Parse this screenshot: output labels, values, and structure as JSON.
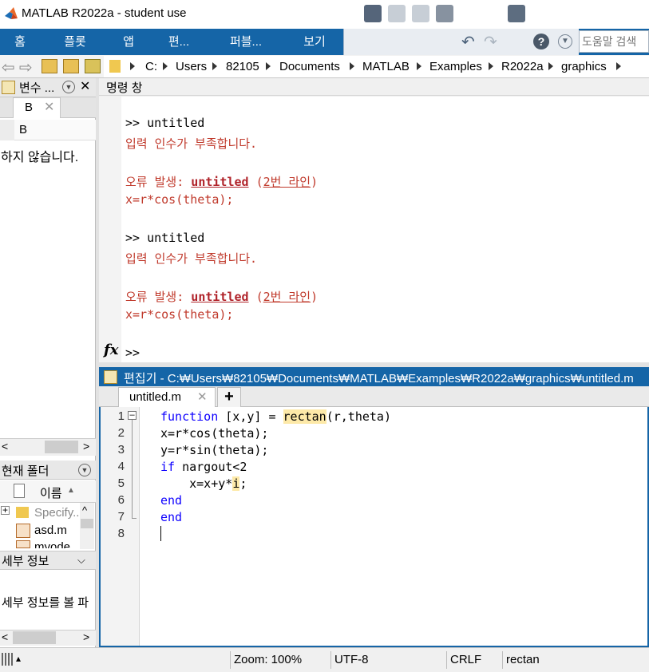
{
  "window": {
    "title": "MATLAB R2022a - student use"
  },
  "ribbon": {
    "tabs": [
      "홈",
      "플롯",
      "앱",
      "편...",
      "퍼블...",
      "보기"
    ],
    "help_search_placeholder": "도움말 검색"
  },
  "address": {
    "crumbs": [
      "C:",
      "Users",
      "82105",
      "Documents",
      "MATLAB",
      "Examples",
      "R2022a",
      "graphics"
    ]
  },
  "workspace_panel": {
    "title": "변수 ...",
    "tab_label": "B",
    "var_header": "B",
    "content": "하지 않습니다."
  },
  "current_folder_panel": {
    "title": "현재 폴더",
    "col_name": "이름",
    "items": [
      "Specify..",
      "asd.m",
      "myode..."
    ]
  },
  "details_panel": {
    "title": "세부 정보",
    "content": "세부 정보를 볼 파"
  },
  "command_window": {
    "title": "명령 창",
    "prompt": ">>",
    "fx": "fx",
    "blocks": [
      {
        "cmd": ">> untitled",
        "err1": "입력 인수가 부족합니다.",
        "err_prefix": "오류 발생: ",
        "err_func": "untitled",
        "err_open": " (",
        "err_line": "2번 라인",
        "err_close": ")",
        "err_code": "x=r*cos(theta);"
      },
      {
        "cmd": ">> untitled",
        "err1": "입력 인수가 부족합니다.",
        "err_prefix": "오류 발생: ",
        "err_func": "untitled",
        "err_open": " (",
        "err_line": "2번 라인",
        "err_close": ")",
        "err_code": "x=r*cos(theta);"
      }
    ]
  },
  "editor": {
    "title": "편집기 - C:₩Users₩82105₩Documents₩MATLAB₩Examples₩R2022a₩graphics₩untitled.m",
    "tab": "untitled.m",
    "add_tab": "+",
    "line_numbers": [
      "1",
      "2",
      "3",
      "4",
      "5",
      "6",
      "7",
      "8"
    ],
    "code": {
      "l1_kw": "function",
      "l1_a": " [x,y] = ",
      "l1_fn": "rectan",
      "l1_b": "(r,theta)",
      "l2": "x=r*cos(theta);",
      "l3": "y=r*sin(theta);",
      "l4_kw": "if",
      "l4_b": " nargout<2",
      "l5_a": "    x=x+y*",
      "l5_i": "i",
      "l5_b": ";",
      "l6": "end",
      "l7": "end"
    }
  },
  "status": {
    "zoom": "Zoom: 100%",
    "encoding": "UTF-8",
    "eol": "CRLF",
    "func": "rectan"
  },
  "colors": {
    "ribbon": "#1565a7",
    "error": "#c0392b",
    "keyword": "#0e00ff"
  }
}
